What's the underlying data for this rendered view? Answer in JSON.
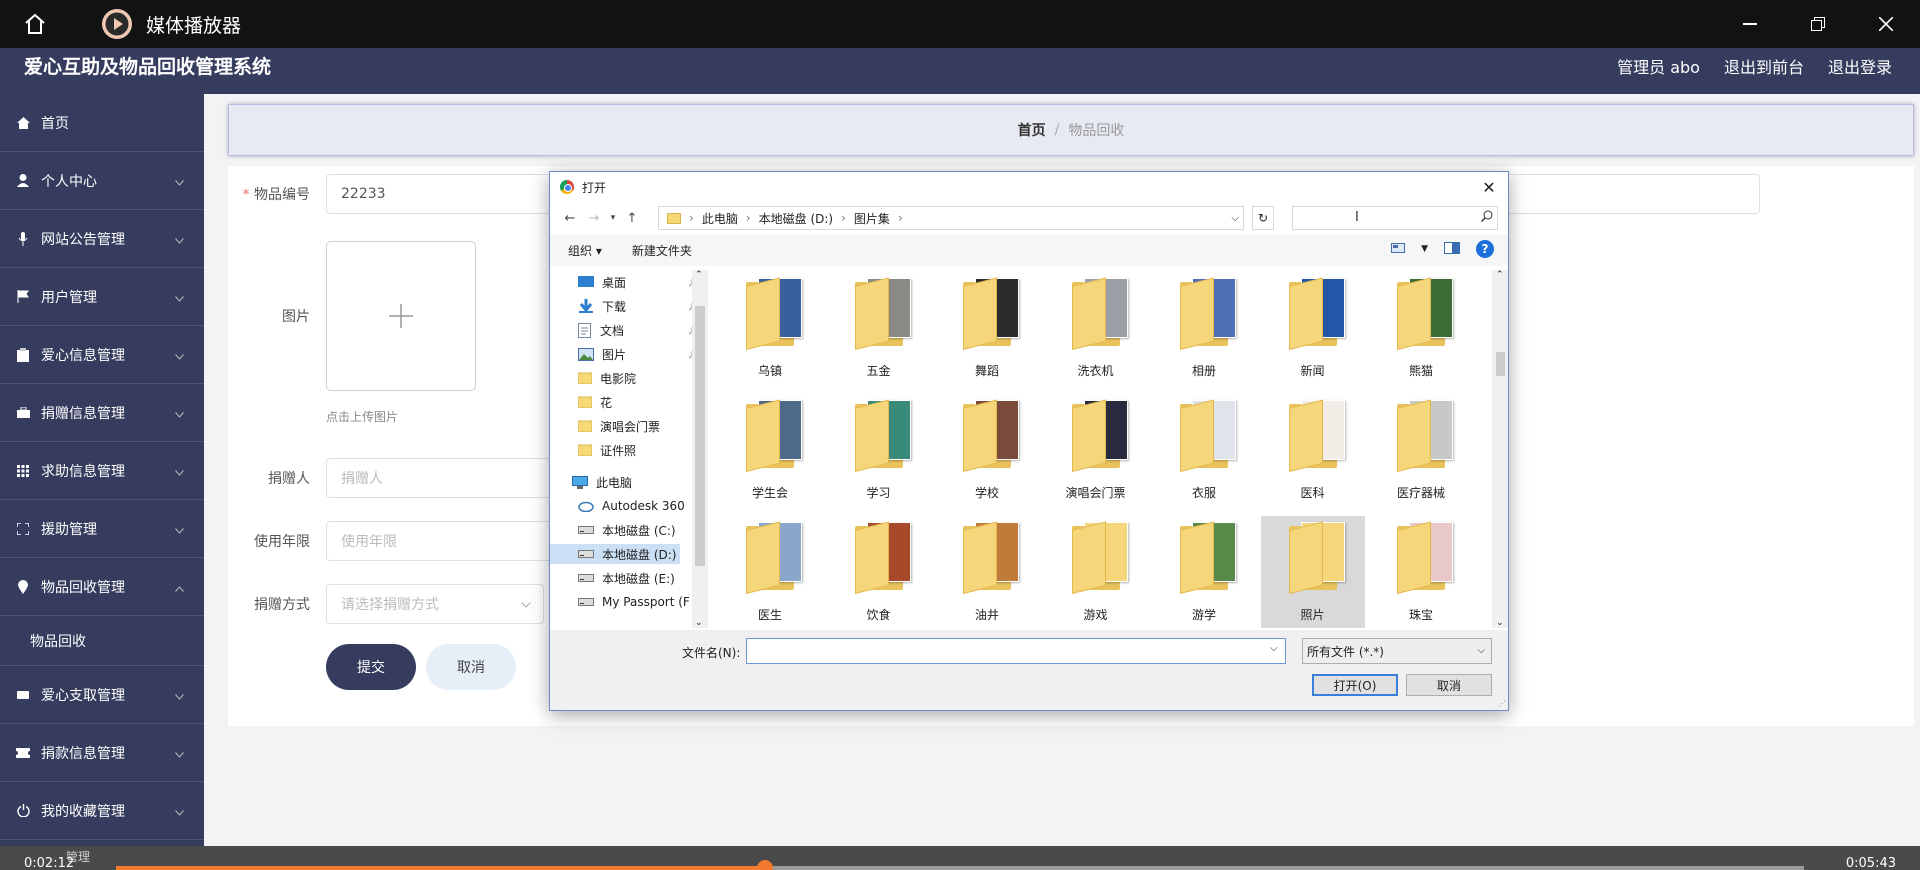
{
  "player": {
    "title": "媒体播放器",
    "current_time": "0:02:12",
    "total_time": "0:05:43",
    "progress": 0.3847,
    "sidebar_overlap_label": "管理"
  },
  "app": {
    "title": "爱心互助及物品回收管理系统",
    "header_links": [
      "管理员 abo",
      "退出到前台",
      "退出登录"
    ]
  },
  "sidebar": {
    "items": [
      {
        "label": "首页",
        "icon": "home-icon"
      },
      {
        "label": "个人中心",
        "icon": "user-icon"
      },
      {
        "label": "网站公告管理",
        "icon": "mic-icon"
      },
      {
        "label": "用户管理",
        "icon": "flag-icon"
      },
      {
        "label": "爱心信息管理",
        "icon": "clipboard-icon"
      },
      {
        "label": "捐赠信息管理",
        "icon": "briefcase-icon"
      },
      {
        "label": "求助信息管理",
        "icon": "grid-icon"
      },
      {
        "label": "援助管理",
        "icon": "scan-icon"
      },
      {
        "label": "物品回收管理",
        "icon": "location-icon"
      },
      {
        "label": "爱心支取管理",
        "icon": "card-icon"
      },
      {
        "label": "捐款信息管理",
        "icon": "ticket-icon"
      },
      {
        "label": "我的收藏管理",
        "icon": "power-icon"
      }
    ],
    "sub_item": "物品回收"
  },
  "breadcrumb": {
    "home": "首页",
    "sep": "/",
    "current": "物品回收"
  },
  "form": {
    "item_no_label": "物品编号",
    "item_no_value": "22233",
    "image_label": "图片",
    "upload_hint": "点击上传图片",
    "donor_label": "捐赠人",
    "donor_placeholder": "捐赠人",
    "years_label": "使用年限",
    "years_placeholder": "使用年限",
    "method_label": "捐赠方式",
    "method_placeholder": "请选择捐赠方式",
    "submit": "提交",
    "cancel": "取消"
  },
  "dialog": {
    "title": "打开",
    "path": [
      "此电脑",
      "本地磁盘 (D:)",
      "图片集"
    ],
    "toolbar": {
      "organize": "组织 ▾",
      "new_folder": "新建文件夹",
      "help": "?"
    },
    "nav": [
      {
        "label": "桌面",
        "icon": "desktop-icon",
        "pinned": true
      },
      {
        "label": "下载",
        "icon": "download-icon",
        "pinned": true
      },
      {
        "label": "文档",
        "icon": "document-icon",
        "pinned": true
      },
      {
        "label": "图片",
        "icon": "picture-icon",
        "pinned": true
      },
      {
        "label": "电影院",
        "icon": "folder-icon"
      },
      {
        "label": "花",
        "icon": "folder-icon"
      },
      {
        "label": "演唱会门票",
        "icon": "folder-icon"
      },
      {
        "label": "证件照",
        "icon": "folder-icon"
      },
      {
        "label": "此电脑",
        "icon": "pc-icon"
      },
      {
        "label": "Autodesk 360",
        "icon": "cloud-icon"
      },
      {
        "label": "本地磁盘 (C:)",
        "icon": "drive-icon"
      },
      {
        "label": "本地磁盘 (D:)",
        "icon": "drive-icon",
        "selected": true
      },
      {
        "label": "本地磁盘 (E:)",
        "icon": "drive-icon"
      },
      {
        "label": "My Passport (F",
        "icon": "drive-icon"
      }
    ],
    "folders": [
      {
        "label": "乌镇",
        "color": "#3a5f9e"
      },
      {
        "label": "五金",
        "color": "#8a8a84"
      },
      {
        "label": "舞蹈",
        "color": "#2b2b2b"
      },
      {
        "label": "洗衣机",
        "color": "#9aa0a6"
      },
      {
        "label": "相册",
        "color": "#4e6fb5"
      },
      {
        "label": "新闻",
        "color": "#2355a8"
      },
      {
        "label": "熊猫",
        "color": "#3d6b34"
      },
      {
        "label": "学生会",
        "color": "#4e6a8a"
      },
      {
        "label": "学习",
        "color": "#3a8a7a"
      },
      {
        "label": "学校",
        "color": "#7a4a3a"
      },
      {
        "label": "演唱会门票",
        "color": "#2a2a3e"
      },
      {
        "label": "衣服",
        "color": "#e0e4ea"
      },
      {
        "label": "医科",
        "color": "#f2ede6"
      },
      {
        "label": "医疗器械",
        "color": "#c8c8c8"
      },
      {
        "label": "医生",
        "color": "#8aa6c8"
      },
      {
        "label": "饮食",
        "color": "#a84a2a"
      },
      {
        "label": "油井",
        "color": "#c07a3a"
      },
      {
        "label": "游戏",
        "color": "#f6d67a"
      },
      {
        "label": "游学",
        "color": "#5a8a4a"
      },
      {
        "label": "照片",
        "color": "#f6d67a"
      },
      {
        "label": "珠宝",
        "color": "#e8c8c8"
      }
    ],
    "selected_folder": "照片",
    "filename_label": "文件名(N):",
    "filename_value": "",
    "filetype": "所有文件 (*.*)",
    "open": "打开(O)",
    "cancel": "取消"
  }
}
